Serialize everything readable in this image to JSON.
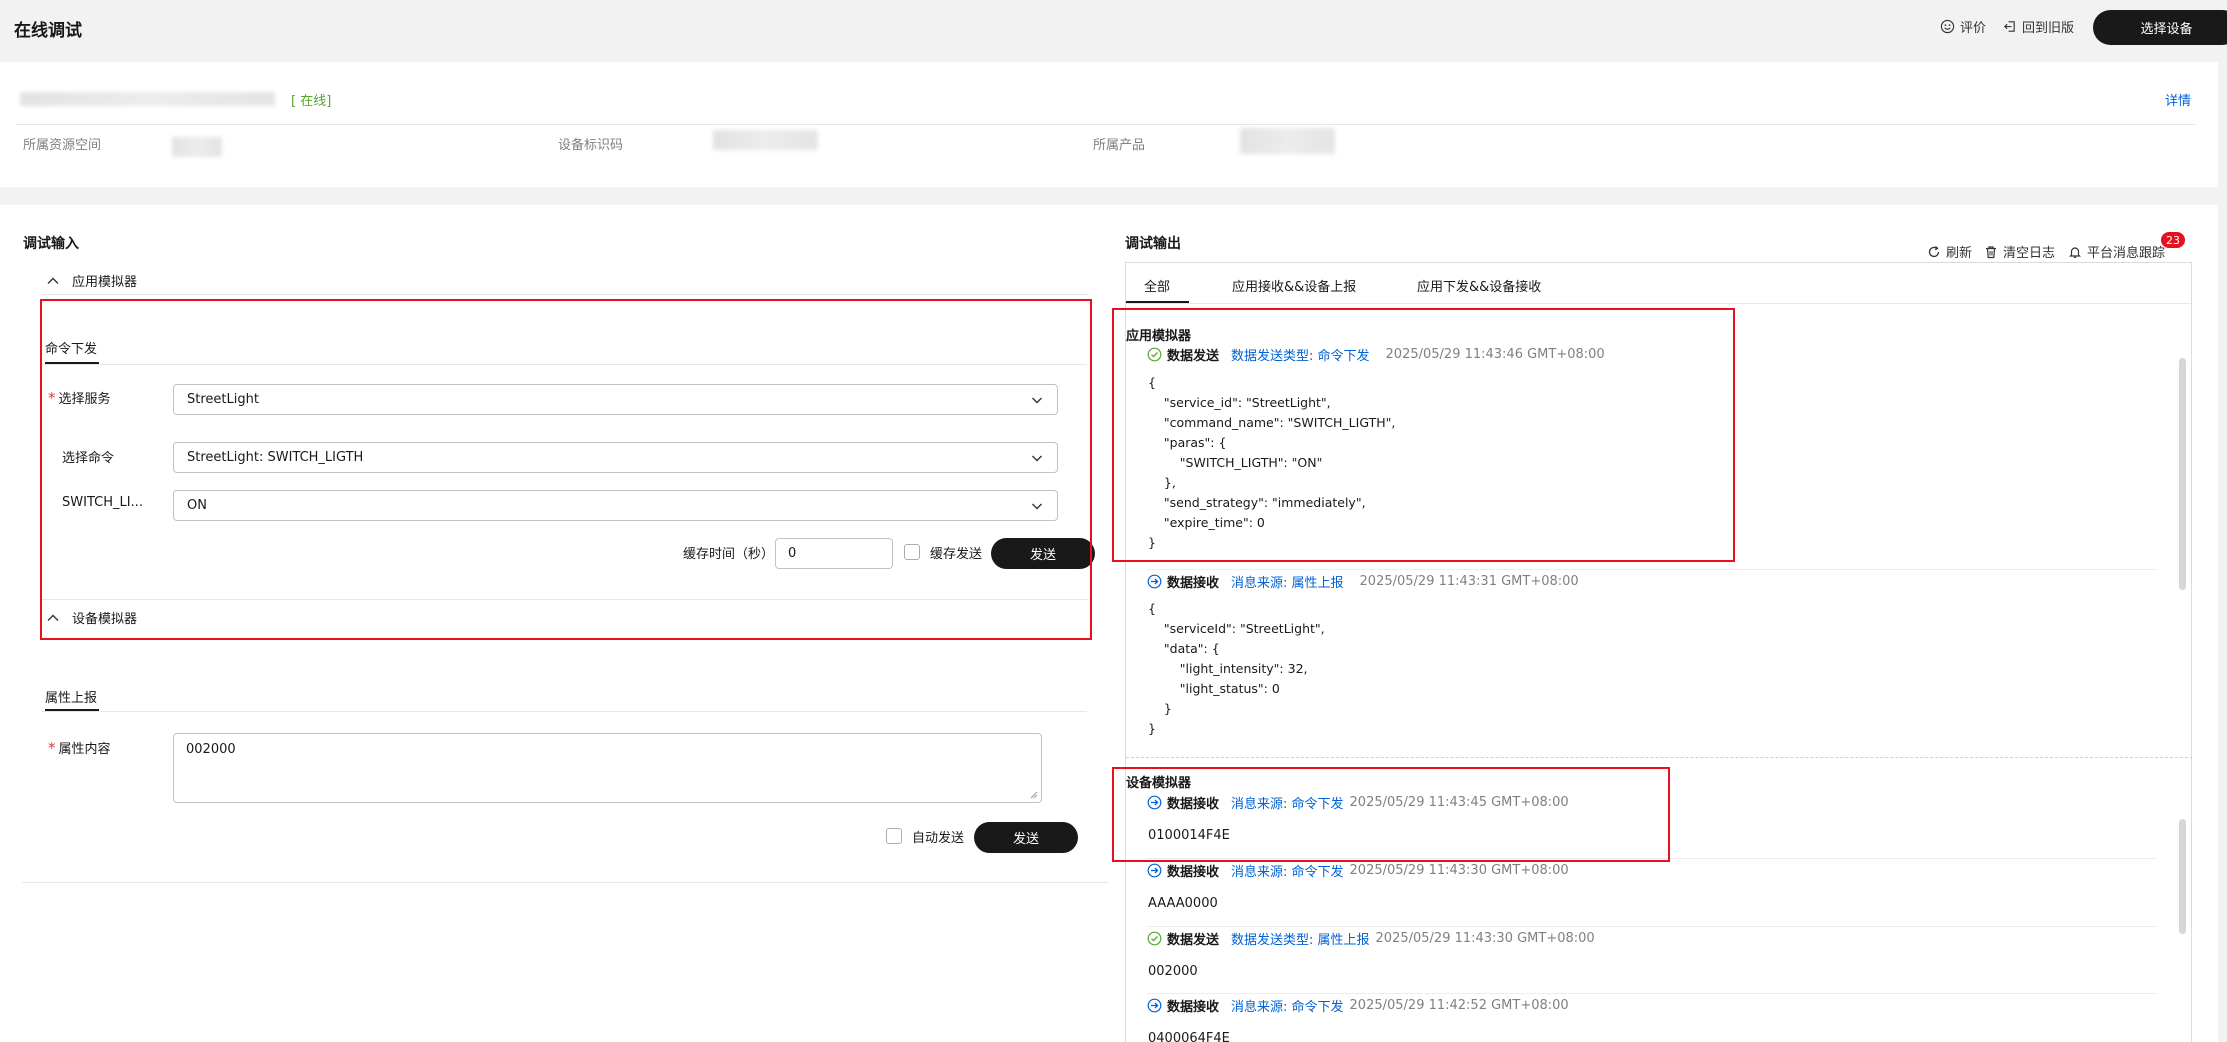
{
  "header": {
    "title": "在线调试",
    "rate_label": "评价",
    "old_version_label": "回到旧版",
    "select_device_label": "选择设备"
  },
  "device": {
    "status": "[ 在线]",
    "detail_label": "详情",
    "resource_space_label": "所属资源空间",
    "device_id_label": "设备标识码",
    "product_label": "所属产品"
  },
  "input": {
    "title": "调试输入",
    "app_simulator": {
      "label": "应用模拟器",
      "tab": "命令下发",
      "service_label": "选择服务",
      "service_value": "StreetLight",
      "command_label": "选择命令",
      "command_value": "StreetLight: SWITCH_LIGTH",
      "param_label": "SWITCH_LI...",
      "param_value": "ON",
      "cache_time_label": "缓存时间（秒）",
      "cache_time_value": "0",
      "cache_send_label": "缓存发送",
      "send_label": "发送"
    },
    "device_simulator": {
      "label": "设备模拟器",
      "tab": "属性上报",
      "content_label": "属性内容",
      "content_value": "002000",
      "auto_send_label": "自动发送",
      "send_label": "发送"
    }
  },
  "output": {
    "title": "调试输出",
    "refresh_label": "刷新",
    "clear_label": "清空日志",
    "trace_label": "平台消息跟踪",
    "badge": "23",
    "tabs": [
      "全部",
      "应用接收&&设备上报",
      "应用下发&&设备接收"
    ],
    "app_group": "应用模拟器",
    "device_group": "设备模拟器",
    "app_entries": [
      {
        "kind": "数据发送",
        "source": "数据发送类型: 命令下发",
        "time": "2025/05/29 11:43:46 GMT+08:00",
        "body": "{\n    \"service_id\": \"StreetLight\",\n    \"command_name\": \"SWITCH_LIGTH\",\n    \"paras\": {\n        \"SWITCH_LIGTH\": \"ON\"\n    },\n    \"send_strategy\": \"immediately\",\n    \"expire_time\": 0\n}"
      },
      {
        "kind": "数据接收",
        "source": "消息来源: 属性上报",
        "time": "2025/05/29 11:43:31 GMT+08:00",
        "body": "{\n    \"serviceId\": \"StreetLight\",\n    \"data\": {\n        \"light_intensity\": 32,\n        \"light_status\": 0\n    }\n}"
      }
    ],
    "device_entries": [
      {
        "kind": "数据接收",
        "source": "消息来源: 命令下发",
        "time": "2025/05/29 11:43:45 GMT+08:00",
        "payload": "0100014F4E"
      },
      {
        "kind": "数据接收",
        "source": "消息来源: 命令下发",
        "time": "2025/05/29 11:43:30 GMT+08:00",
        "payload": "AAAA0000"
      },
      {
        "kind": "数据发送",
        "source": "数据发送类型: 属性上报",
        "time": "2025/05/29 11:43:30 GMT+08:00",
        "payload": "002000"
      },
      {
        "kind": "数据接收",
        "source": "消息来源: 命令下发",
        "time": "2025/05/29 11:42:52 GMT+08:00",
        "payload": "0400064F4E"
      }
    ]
  },
  "colors": {
    "accent_link": "#0062d4",
    "online_green": "#52a82c",
    "highlight_red": "#e8101e",
    "button_dark": "#191919"
  }
}
